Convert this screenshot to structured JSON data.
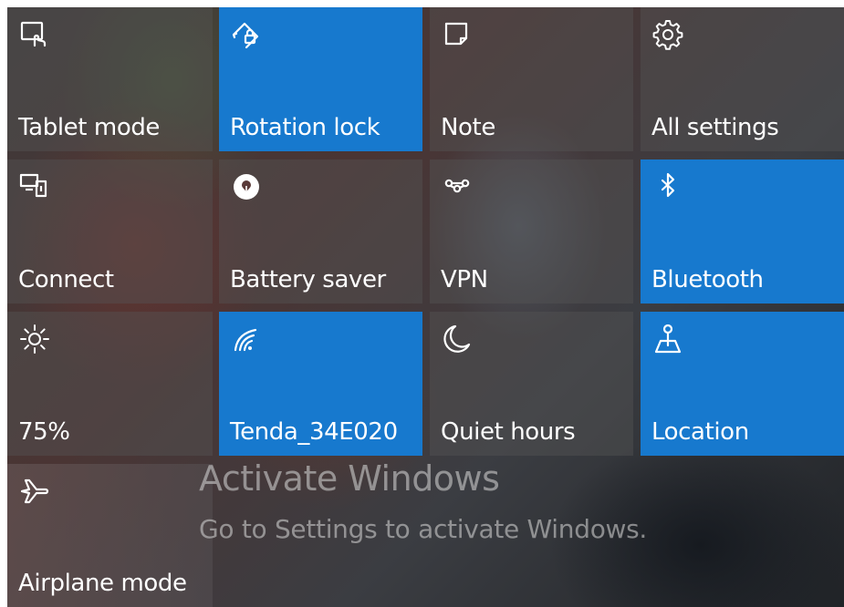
{
  "quick_actions": {
    "tiles": [
      {
        "label": "Tablet mode",
        "icon": "tablet-mode-icon",
        "state": "off"
      },
      {
        "label": "Rotation lock",
        "icon": "rotation-lock-icon",
        "state": "on"
      },
      {
        "label": "Note",
        "icon": "note-icon",
        "state": "off"
      },
      {
        "label": "All settings",
        "icon": "gear-icon",
        "state": "off"
      },
      {
        "label": "Connect",
        "icon": "connect-icon",
        "state": "off"
      },
      {
        "label": "Battery saver",
        "icon": "battery-saver-icon",
        "state": "off"
      },
      {
        "label": "VPN",
        "icon": "vpn-icon",
        "state": "off"
      },
      {
        "label": "Bluetooth",
        "icon": "bluetooth-icon",
        "state": "on"
      },
      {
        "label": "75%",
        "icon": "brightness-icon",
        "state": "off"
      },
      {
        "label": "Tenda_34E020",
        "icon": "wifi-icon",
        "state": "on"
      },
      {
        "label": "Quiet hours",
        "icon": "moon-icon",
        "state": "off"
      },
      {
        "label": "Location",
        "icon": "location-icon",
        "state": "on"
      },
      {
        "label": "Airplane mode",
        "icon": "airplane-icon",
        "state": "off"
      }
    ]
  },
  "watermark": {
    "title": "Activate Windows",
    "subtitle": "Go to Settings to activate Windows."
  },
  "colors": {
    "active_tile": "#1779ce",
    "inactive_tile": "rgba(85,85,85,0.42)",
    "text": "#ffffff",
    "watermark_text": "rgba(200,200,200,0.62)"
  }
}
